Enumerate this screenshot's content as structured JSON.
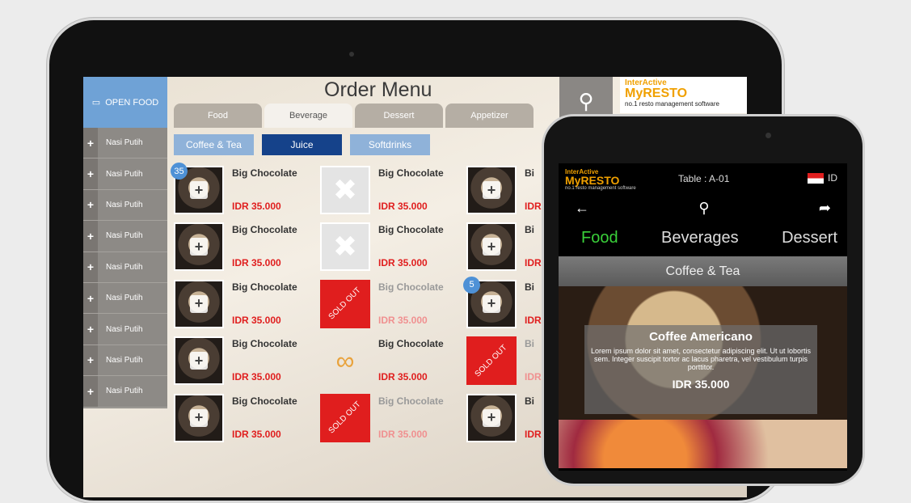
{
  "tablet": {
    "title": "Order Menu",
    "open_food": "OPEN FOOD",
    "sidebar_items": [
      "Nasi Putih",
      "Nasi Putih",
      "Nasi Putih",
      "Nasi Putih",
      "Nasi Putih",
      "Nasi Putih",
      "Nasi Putih",
      "Nasi Putih",
      "Nasi Putih"
    ],
    "tabs": [
      "Food",
      "Beverage",
      "Dessert",
      "Appetizer"
    ],
    "active_tab": "Beverage",
    "subtabs": [
      "Coffee & Tea",
      "Juice",
      "Softdrinks"
    ],
    "active_subtab": "Juice",
    "sold_out_label": "SOLD OUT",
    "items": [
      {
        "name": "Big Chocolate",
        "price": "IDR 35.000",
        "badge": "35",
        "state": "image"
      },
      {
        "name": "Big Chocolate",
        "price": "IDR 35.000",
        "state": "no-image"
      },
      {
        "name": "Bi",
        "price": "IDR",
        "state": "image"
      },
      {
        "name": "Big Chocolate",
        "price": "IDR 35.000",
        "state": "image"
      },
      {
        "name": "Big Chocolate",
        "price": "IDR 35.000",
        "state": "no-image"
      },
      {
        "name": "Bi",
        "price": "IDR",
        "state": "image"
      },
      {
        "name": "Big Chocolate",
        "price": "IDR 35.000",
        "state": "image"
      },
      {
        "name": "Big Chocolate",
        "price": "IDR 35.000",
        "state": "sold-out"
      },
      {
        "name": "Bi",
        "price": "IDR",
        "badge": "5",
        "state": "image"
      },
      {
        "name": "Big Chocolate",
        "price": "IDR 35.000",
        "state": "image"
      },
      {
        "name": "Big Chocolate",
        "price": "IDR 35.000",
        "state": "loading"
      },
      {
        "name": "Bi",
        "price": "IDR",
        "state": "sold-out"
      },
      {
        "name": "Big Chocolate",
        "price": "IDR 35.000",
        "state": "image"
      },
      {
        "name": "Big Chocolate",
        "price": "IDR 35.000",
        "state": "sold-out"
      },
      {
        "name": "Bi",
        "price": "IDR",
        "state": "image"
      }
    ],
    "logo": {
      "line1": "InterActive",
      "line2": "MyRESTO",
      "line3": "no.1 resto management software"
    }
  },
  "phone": {
    "logo": {
      "line1": "InterActive",
      "line2": "MyRESTO",
      "line3": "no.1 resto management software"
    },
    "table": "Table : A-01",
    "lang": "ID",
    "categories": [
      "Food",
      "Beverages",
      "Dessert"
    ],
    "active_category": "Food",
    "section": "Coffee & Tea",
    "card": {
      "name": "Coffee Americano",
      "desc": "Lorem ipsum dolor sit amet, consectetur adipiscing elit. Ut ut lobortis sem. Integer suscipit tortor ac lacus pharetra, vel vestibulum turpis porttitor.",
      "price": "IDR 35.000"
    }
  }
}
